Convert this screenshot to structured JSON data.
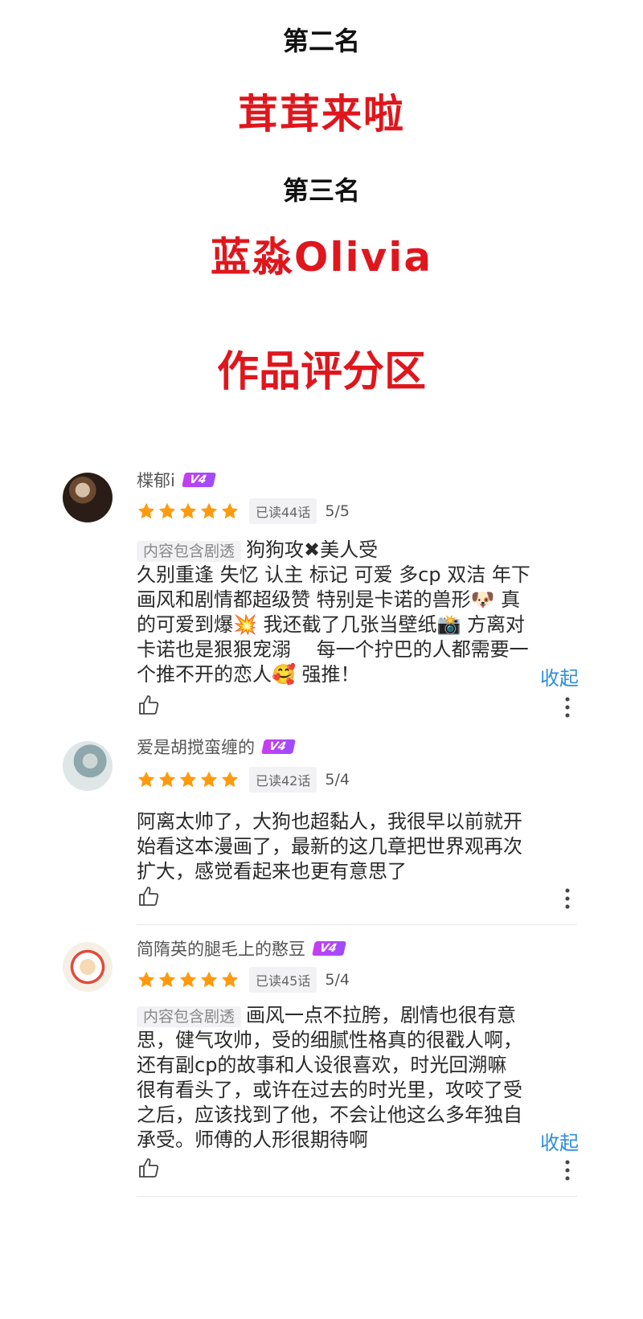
{
  "ranks": [
    {
      "label": "第二名",
      "name": "茸茸来啦"
    },
    {
      "label": "第三名",
      "name": "蓝淼Olivia"
    }
  ],
  "section_title": "作品评分区",
  "colors": {
    "accent_red": "#e0161d",
    "star": "#ff9a0e",
    "link_blue": "#2e8fd8",
    "vip": "#b344f5"
  },
  "reviews": [
    {
      "username": "楪郁i",
      "vip": "V4",
      "stars": 5,
      "read": "已读44话",
      "score": "5/5",
      "spoiler": "内容包含剧透",
      "lines": [
        "狗狗攻✖美人受",
        "久别重逢 失忆 认主 标记 可爱 多cp 双洁 年下",
        "画风和剧情都超级赞 特别是卡诺的兽形🐶 真",
        "的可爱到爆💥 我还截了几张当壁纸📸 方离对",
        "卡诺也是狠狠宠溺　 每一个拧巴的人都需要一",
        "个推不开的恋人🥰 强推！"
      ],
      "collapse": "收起"
    },
    {
      "username": "爱是胡搅蛮缠的",
      "vip": "V4",
      "stars": 5,
      "read": "已读42话",
      "score": "5/4",
      "lines": [
        "阿离太帅了，大狗也超黏人，我很早以前就开",
        "始看这本漫画了，最新的这几章把世界观再次",
        "扩大，感觉看起来也更有意思了"
      ]
    },
    {
      "username": "简隋英的腿毛上的憨豆",
      "vip": "V4",
      "stars": 5,
      "read": "已读45话",
      "score": "5/4",
      "spoiler": "内容包含剧透",
      "lines": [
        "画风一点不拉胯，剧情也很有意",
        "思，健气攻帅，受的细腻性格真的很戳人啊，",
        "还有副cp的故事和人设很喜欢，时光回溯嘛",
        "很有看头了，或许在过去的时光里，攻咬了受",
        "之后，应该找到了他，不会让他这么多年独自",
        "承受。师傅的人形很期待啊"
      ],
      "collapse": "收起"
    }
  ],
  "icons": {
    "like": "thumbs-up-icon",
    "more": "more-vertical-icon",
    "star": "star-icon"
  }
}
